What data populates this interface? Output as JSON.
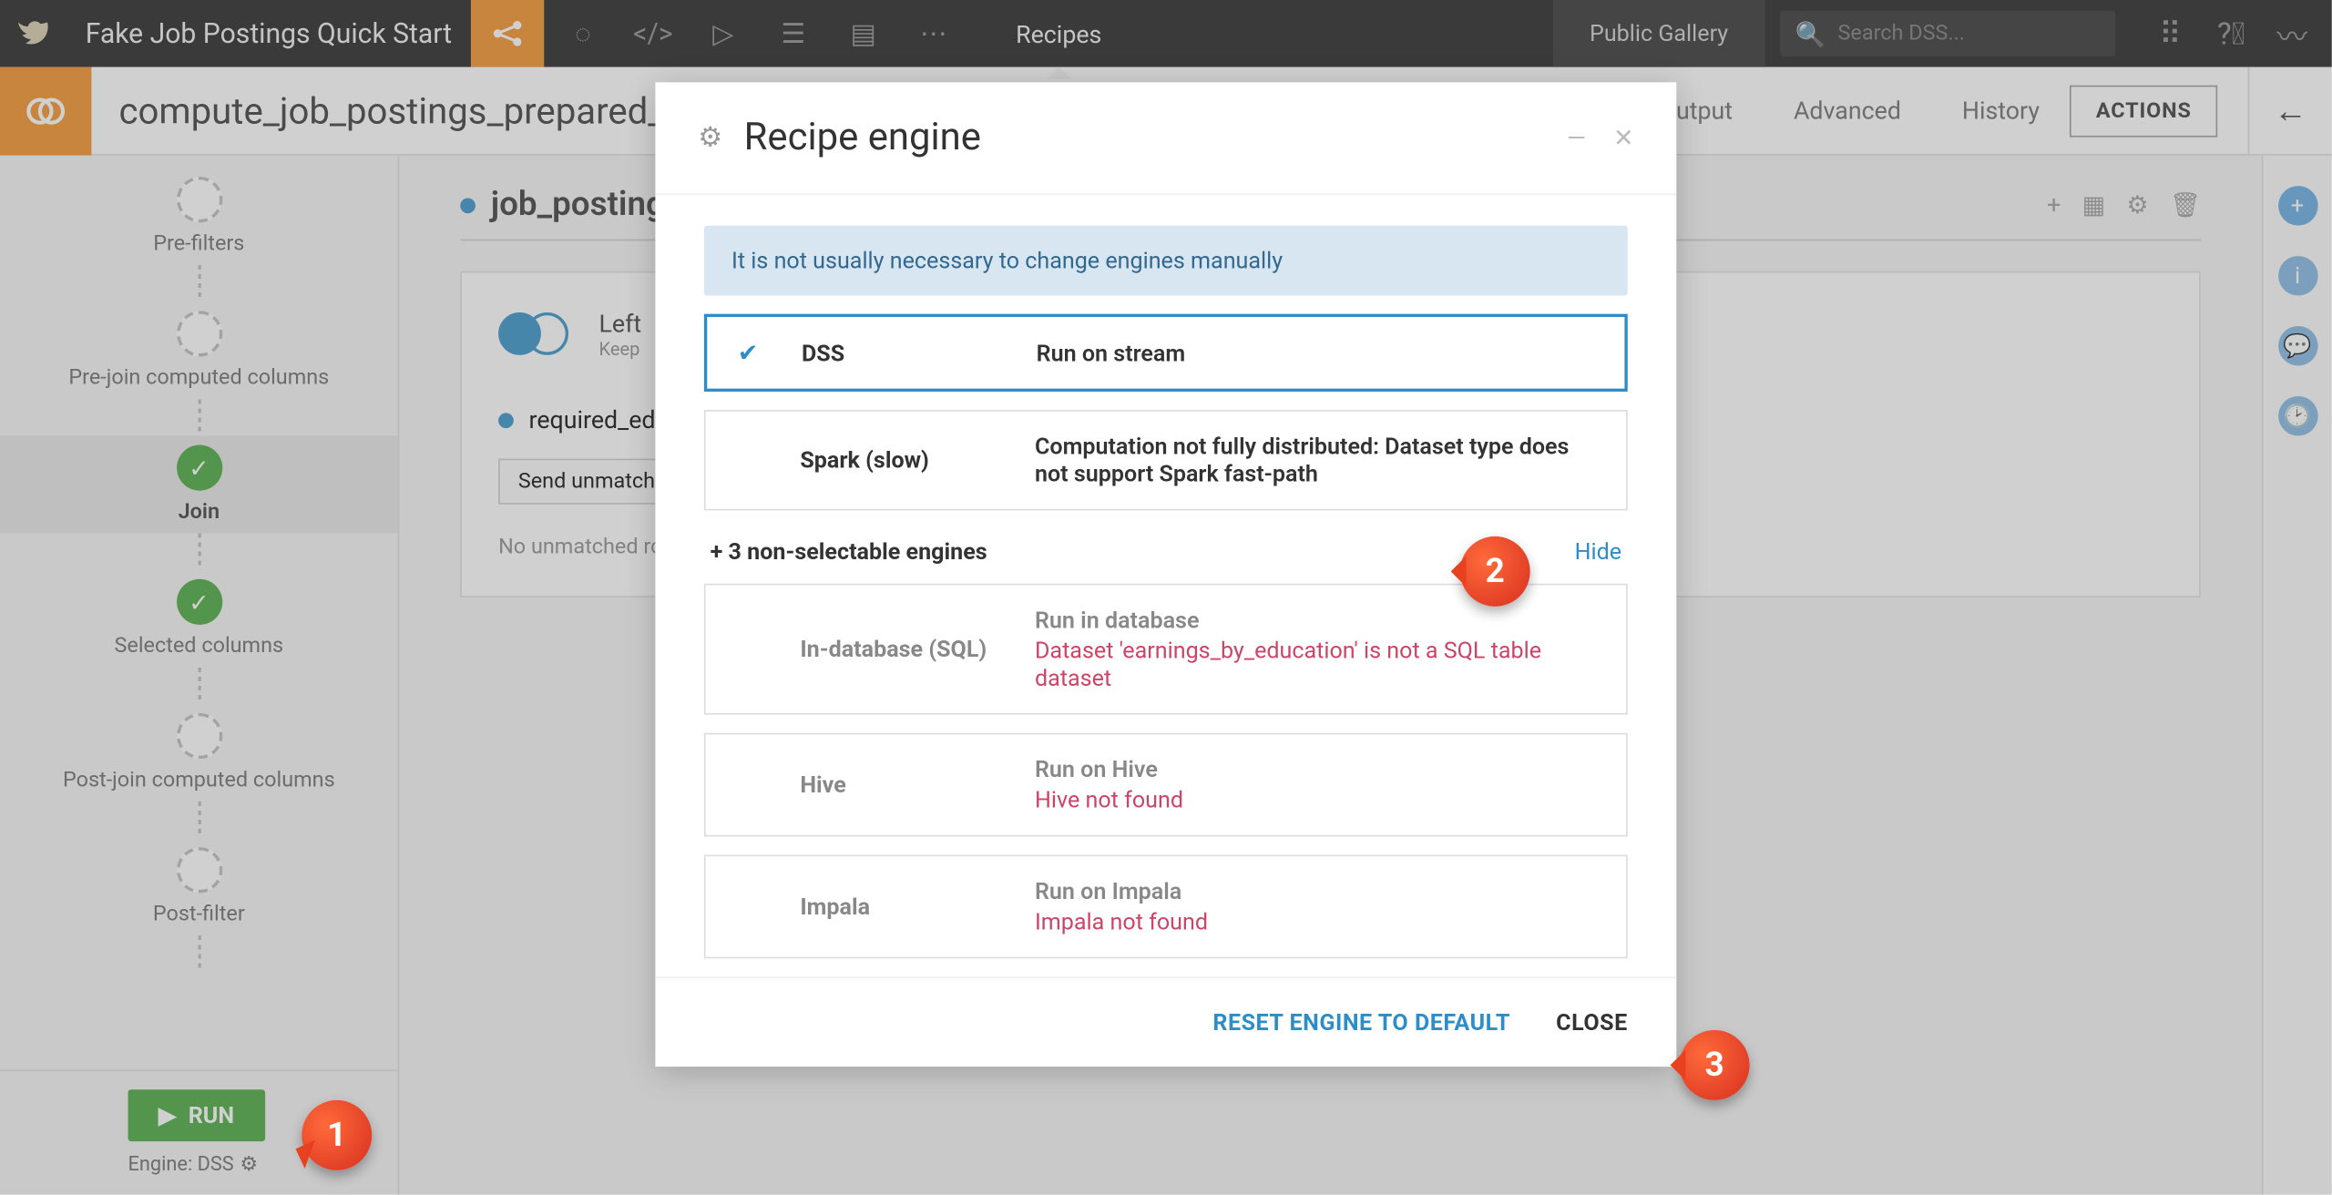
{
  "topbar": {
    "project": "Fake Job Postings Quick Start",
    "tab": "Recipes",
    "public_gallery": "Public Gallery",
    "search_placeholder": "Search DSS..."
  },
  "subheader": {
    "title": "compute_job_postings_prepared_joi",
    "tabs": {
      "io": "t / Output",
      "advanced": "Advanced",
      "history": "History"
    },
    "actions": "ACTIONS"
  },
  "steps": {
    "prefilters": "Pre-filters",
    "prejoin": "Pre-join computed columns",
    "join": "Join",
    "selected": "Selected columns",
    "postjoin": "Post-join computed columns",
    "postfilter": "Post-filter"
  },
  "run": {
    "button": "RUN",
    "engine_label": "Engine: DSS"
  },
  "content": {
    "dataset": "job_postings_",
    "join_type": "Left",
    "join_sub": "Keep",
    "required": "required_educati",
    "send": "Send unmatched ro",
    "no_rows": "No unmatched row"
  },
  "modal": {
    "title": "Recipe engine",
    "banner": "It is not usually necessary to change engines manually",
    "dss": {
      "name": "DSS",
      "desc": "Run on stream"
    },
    "spark": {
      "name": "Spark (slow)",
      "desc": "Computation not fully distributed: Dataset type does not support Spark fast-path"
    },
    "nonselectable": "+ 3 non-selectable engines",
    "hide": "Hide",
    "sql": {
      "name": "In-database (SQL)",
      "desc": "Run in database",
      "err": "Dataset 'earnings_by_education' is not a SQL table dataset"
    },
    "hive": {
      "name": "Hive",
      "desc": "Run on Hive",
      "err": "Hive not found"
    },
    "impala": {
      "name": "Impala",
      "desc": "Run on Impala",
      "err": "Impala not found"
    },
    "reset": "RESET ENGINE TO DEFAULT",
    "close": "CLOSE"
  },
  "callouts": {
    "one": "1",
    "two": "2",
    "three": "3"
  }
}
